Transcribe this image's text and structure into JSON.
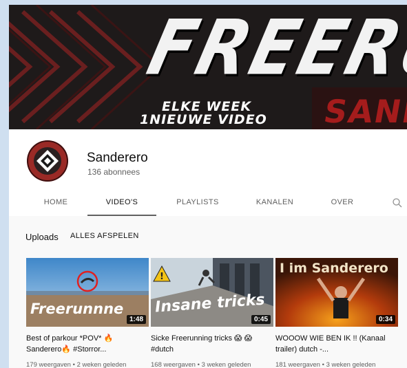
{
  "banner": {
    "title": "FREERU",
    "line1": "ELKE WEEK",
    "line2": "1NIEUWE VIDEO",
    "brand": "SANDE"
  },
  "channel": {
    "name": "Sanderero",
    "subscribers": "136 abonnees"
  },
  "tabs": [
    {
      "label": "HOME"
    },
    {
      "label": "VIDEO'S"
    },
    {
      "label": "PLAYLISTS"
    },
    {
      "label": "KANALEN"
    },
    {
      "label": "OVER"
    }
  ],
  "uploads": {
    "label": "Uploads",
    "play_all": "ALLES AFSPELEN"
  },
  "videos": [
    {
      "thumb_text": "Freerunnne",
      "duration": "1:48",
      "title": "Best of parkour *POV* 🔥 Sanderero🔥 #Storror...",
      "meta": "179 weergaven • 2 weken geleden"
    },
    {
      "thumb_text": "Insane tricks",
      "duration": "0:45",
      "title": "Sicke Freerunning tricks 😱 😱 #dutch",
      "meta": "168 weergaven • 3 weken geleden"
    },
    {
      "thumb_text": "I im Sanderero",
      "duration": "0:34",
      "title": "WOOOW WIE BEN IK !! (Kanaal trailer) dutch -...",
      "meta": "181 weergaven • 3 weken geleden"
    }
  ],
  "colors": {
    "accent_red": "#a51c1c",
    "banner_bg": "#1e1a1a",
    "text_secondary": "#606060"
  }
}
